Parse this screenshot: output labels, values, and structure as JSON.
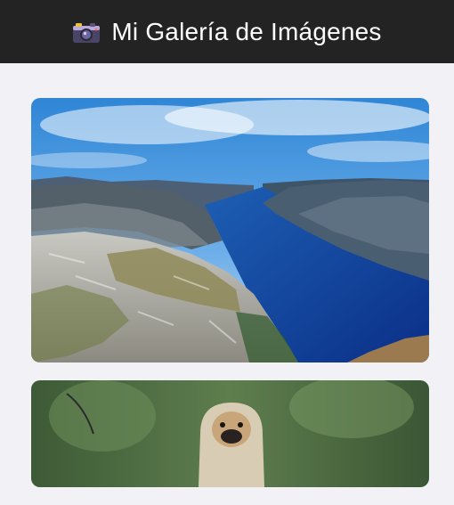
{
  "header": {
    "icon": "camera-icon",
    "title": "Mi Galería de Imágenes",
    "background": "#232323"
  },
  "gallery": {
    "items": [
      {
        "subject": "fjord-landscape"
      },
      {
        "subject": "pug-dog-in-hood"
      }
    ]
  }
}
